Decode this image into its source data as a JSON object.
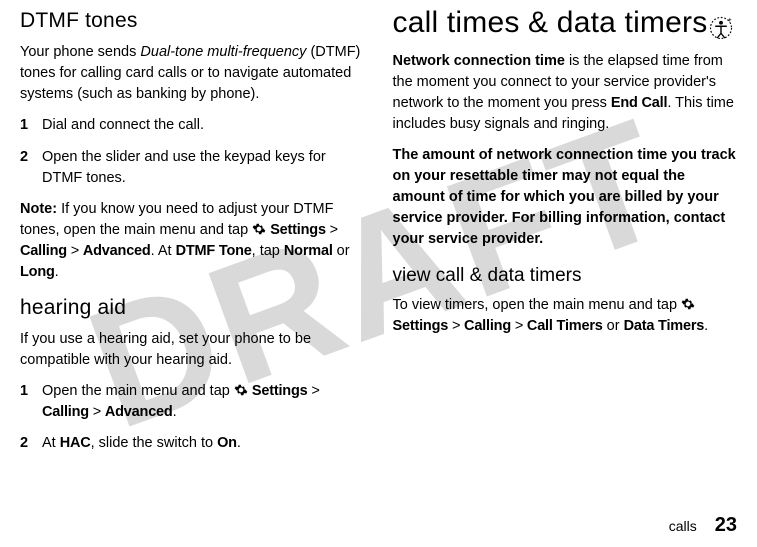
{
  "watermark": "DRAFT",
  "left": {
    "h_dtmf": "DTMF tones",
    "p_dtmf_a": "Your phone sends ",
    "p_dtmf_italic": "Dual-tone multi-frequency",
    "p_dtmf_b": " (DTMF) tones for calling card calls or to navigate automated systems (such as banking by phone).",
    "step1_n": "1",
    "step1_t": "Dial and connect the call.",
    "step2_n": "2",
    "step2_t": "Open the slider and use the keypad keys for DTMF tones.",
    "note_label": "Note:",
    "note_a": " If you know you need to adjust your DTMF tones, open the main menu and tap ",
    "settings": "Settings",
    "gt1": " > ",
    "calling": "Calling",
    "gt2": " > ",
    "advanced": "Advanced",
    "note_b": ". At ",
    "dtmf_tone": "DTMF Tone",
    "note_c": ", tap ",
    "normal": "Normal",
    "or": " or ",
    "long": "Long",
    "period": ".",
    "h_hearing": "hearing aid",
    "p_hearing": "If you use a hearing aid, set your phone to be compatible with your hearing aid.",
    "h_step1_n": "1",
    "h_step1_a": "Open the main menu and tap ",
    "h_step2_n": "2",
    "h_step2_a": "At ",
    "hac": "HAC",
    "h_step2_b": ", slide the switch to ",
    "on": "On",
    "h_step2_c": "."
  },
  "right": {
    "h_main": "call times & data timers",
    "nct_label": "Network connection time",
    "p1_a": " is the elapsed time from the moment you connect to your service provider's network to the moment you press ",
    "end_call": "End Call",
    "p1_b": ". This time includes busy signals and ringing.",
    "p2": "The amount of network connection time you track on your resettable timer may not equal the amount of time for which you are billed by your service provider. For billing information, contact your service provider.",
    "h_view": "view call & data timers",
    "p_view_a": "To view timers, open the main menu and tap ",
    "settings": "Settings",
    "gt1": " > ",
    "calling": "Calling",
    "gt2": " > ",
    "call_timers": "Call Timers",
    "or": " or ",
    "data_timers": "Data Timers",
    "period": "."
  },
  "footer": {
    "section": "calls",
    "page": "23"
  },
  "icons": {
    "gear": "gear-icon",
    "corner": "accessibility-icon"
  }
}
